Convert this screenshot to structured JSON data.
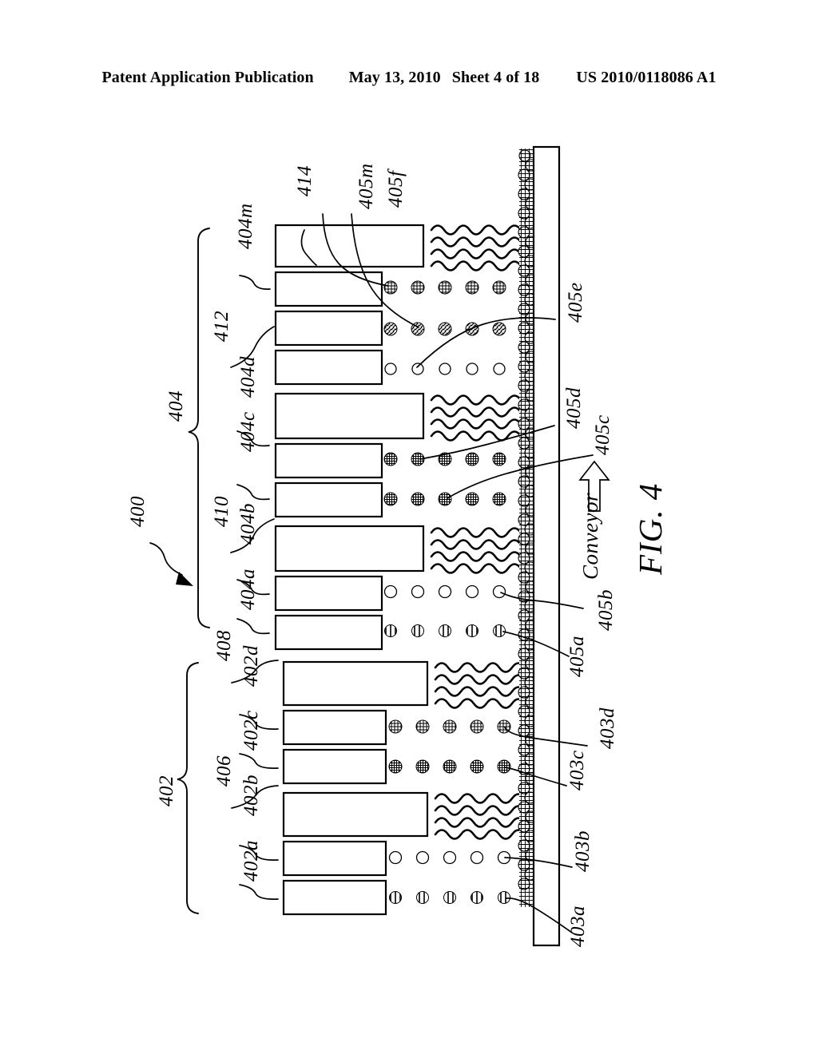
{
  "header": {
    "publication": "Patent Application Publication",
    "date": "May 13, 2010",
    "sheet": "Sheet 4 of 18",
    "patent_number": "US 2010/0118086 A1"
  },
  "figure": {
    "caption": "FIG. 4",
    "conveyor_label": "Conveyor",
    "system_numeral": "400",
    "group_labels": [
      {
        "id": "402",
        "text": "402"
      },
      {
        "id": "404",
        "text": "404"
      }
    ],
    "left_numerals": [
      {
        "text": "414"
      },
      {
        "text": "405m"
      },
      {
        "text": "405f"
      },
      {
        "text": "404m"
      },
      {
        "text": "412"
      },
      {
        "text": "404d"
      },
      {
        "text": "404c"
      },
      {
        "text": "404"
      },
      {
        "text": "410"
      },
      {
        "text": "404b"
      },
      {
        "text": "404a"
      },
      {
        "text": "408"
      },
      {
        "text": "400"
      },
      {
        "text": "402d"
      },
      {
        "text": "402c"
      },
      {
        "text": "406"
      },
      {
        "text": "402b"
      },
      {
        "text": "402a"
      },
      {
        "text": "402"
      }
    ],
    "right_numerals": [
      {
        "text": "405e"
      },
      {
        "text": "405d"
      },
      {
        "text": "405c"
      },
      {
        "text": "405b"
      },
      {
        "text": "405a"
      },
      {
        "text": "403d"
      },
      {
        "text": "403c"
      },
      {
        "text": "403b"
      },
      {
        "text": "403a"
      }
    ],
    "colors": {
      "ink": "#000000",
      "paper": "#ffffff"
    }
  },
  "chart_data": {
    "type": "diagram",
    "title": "FIG. 4",
    "description": "Printhead modules discharging onto a conveyor",
    "module_rows": [
      {
        "index": 0,
        "bar": "long",
        "pattern": "wave",
        "numeral": "414"
      },
      {
        "index": 1,
        "bar": "short",
        "pattern": "dots-crosshatch",
        "numeral": "405m"
      },
      {
        "index": 2,
        "bar": "short",
        "pattern": "dots-slash",
        "numeral": "405f"
      },
      {
        "index": 3,
        "bar": "short",
        "pattern": "dots-open",
        "numeral": "405e"
      },
      {
        "index": 4,
        "bar": "long",
        "pattern": "wave",
        "numeral": "404d"
      },
      {
        "index": 5,
        "bar": "short",
        "pattern": "dots-dense",
        "numeral": "405d"
      },
      {
        "index": 6,
        "bar": "short",
        "pattern": "dots-dense",
        "numeral": "405c"
      },
      {
        "index": 7,
        "bar": "long",
        "pattern": "wave",
        "numeral": "404b"
      },
      {
        "index": 8,
        "bar": "short",
        "pattern": "dots-open",
        "numeral": "405b"
      },
      {
        "index": 9,
        "bar": "short",
        "pattern": "dots-half",
        "numeral": "405a"
      },
      {
        "index": 10,
        "bar": "long",
        "pattern": "wave",
        "numeral": "402d"
      },
      {
        "index": 11,
        "bar": "short",
        "pattern": "dots-crosshatch",
        "numeral": "403d"
      },
      {
        "index": 12,
        "bar": "short",
        "pattern": "dots-dense",
        "numeral": "403c"
      },
      {
        "index": 13,
        "bar": "long",
        "pattern": "wave",
        "numeral": "402b"
      },
      {
        "index": 14,
        "bar": "short",
        "pattern": "dots-open",
        "numeral": "403b"
      },
      {
        "index": 15,
        "bar": "short",
        "pattern": "dots-half",
        "numeral": "403a"
      }
    ],
    "dots_per_row": 5,
    "wave_rows": 4,
    "conveyor_direction": "up"
  }
}
